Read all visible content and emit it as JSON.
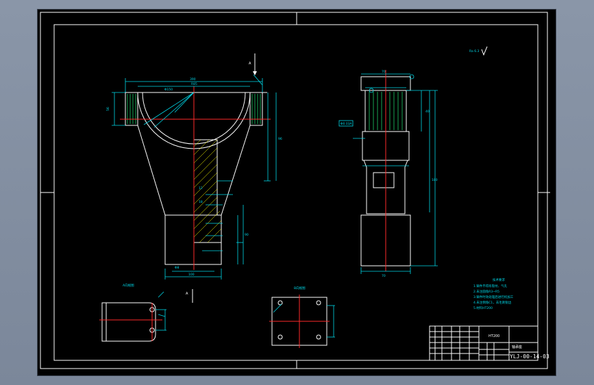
{
  "drawing": {
    "roughness_note": "Ra 6.3",
    "section_label_a": "A",
    "section_label_b": "A",
    "view_b_label": "A向视图",
    "view_c_label": "B向视图",
    "tech_req_title": "技术要求",
    "tech_req_lines": [
      "1.铸件不得有裂纹、气孔",
      "2.未注圆角R3~R5",
      "3.铸件时效处理后进行机加工",
      "4.未注倒角C1，去毛刺锐边",
      "5.材料HT200"
    ]
  },
  "title_block": {
    "part_name": "轴承座",
    "material": "HT200",
    "drawing_number": "YLJ-00-14-03"
  },
  "colors": {
    "paper": "#000000",
    "outline": "#ffffff",
    "dimension": "#00d8e8",
    "centerline": "#ff2a2a",
    "hidden": "#1fd06a",
    "window_frame": "#7b879a"
  }
}
